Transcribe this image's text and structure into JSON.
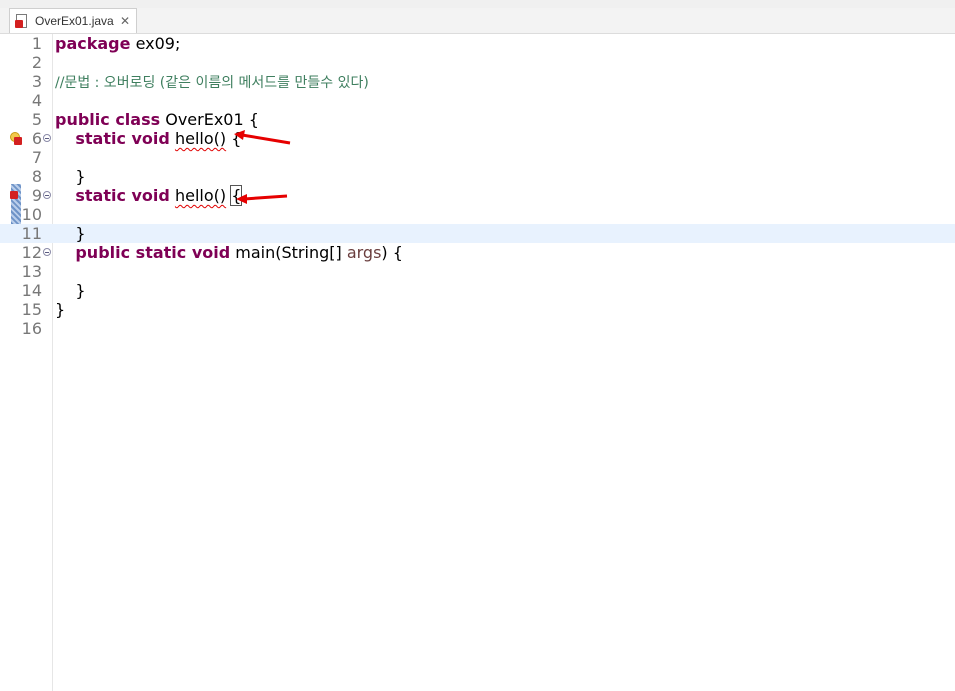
{
  "editor_tab": {
    "filename": "OverEx01.java",
    "close_glyph": "✕"
  },
  "icons": {
    "file": "java-file-error-icon",
    "close": "close-icon",
    "fold": "fold-collapse-icon",
    "error_marker": "error-quickfix-icon"
  },
  "colors": {
    "keyword": "#7f0055",
    "comment": "#3f7f5f",
    "variable": "#6a3e3e",
    "current_line": "#e8f2fe",
    "annotation_arrow": "#e60000"
  },
  "lines": [
    {
      "n": "1",
      "package_kw": "package",
      "rest": " ex09;"
    },
    {
      "n": "2"
    },
    {
      "n": "3",
      "comment": "//문법 : 오버로딩 (같은 이름의 메서드를 만들수 있다)"
    },
    {
      "n": "4"
    },
    {
      "n": "5",
      "kw": "public class",
      "rest": " OverEx01 {"
    },
    {
      "n": "6",
      "kw": "static void",
      "name": "hello()",
      "rest": " {"
    },
    {
      "n": "7"
    },
    {
      "n": "8",
      "rest": "}"
    },
    {
      "n": "9",
      "kw": "static void",
      "name": "hello()",
      "rest": "{"
    },
    {
      "n": "10"
    },
    {
      "n": "11",
      "rest": "}"
    },
    {
      "n": "12",
      "kw": "public static void",
      "call": " main(String[] ",
      "param": "args",
      "rest": ") {"
    },
    {
      "n": "13"
    },
    {
      "n": "14",
      "rest": "}"
    },
    {
      "n": "15",
      "rest": "}"
    },
    {
      "n": "16"
    }
  ]
}
